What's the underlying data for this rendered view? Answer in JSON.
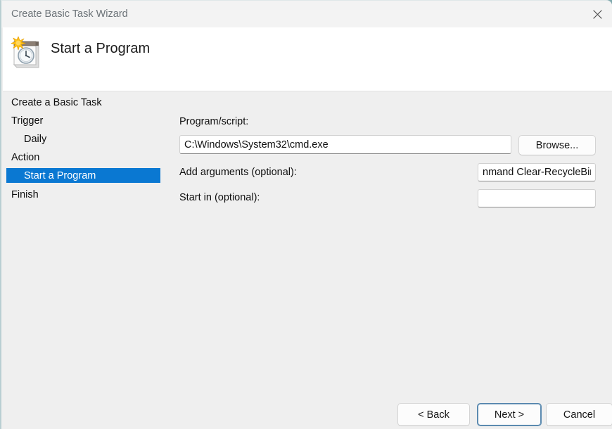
{
  "window": {
    "title": "Create Basic Task Wizard",
    "close_icon": "close-icon"
  },
  "header": {
    "title": "Start a Program",
    "icon": "scheduled-task-icon"
  },
  "sidebar": {
    "items": [
      {
        "label": "Create a Basic Task",
        "indent": false,
        "selected": false
      },
      {
        "label": "Trigger",
        "indent": false,
        "selected": false
      },
      {
        "label": "Daily",
        "indent": true,
        "selected": false
      },
      {
        "label": "Action",
        "indent": false,
        "selected": false
      },
      {
        "label": "Start a Program",
        "indent": true,
        "selected": true
      },
      {
        "label": "Finish",
        "indent": false,
        "selected": false
      }
    ]
  },
  "form": {
    "program_label": "Program/script:",
    "program_value": "C:\\Windows\\System32\\cmd.exe",
    "program_placeholder": "",
    "browse_label": "Browse...",
    "arguments_label": "Add arguments (optional):",
    "arguments_value": "nmand Clear-RecycleBin\"",
    "arguments_placeholder": "",
    "startin_label": "Start in (optional):",
    "startin_value": "",
    "startin_placeholder": ""
  },
  "footer": {
    "back_label": "< Back",
    "next_label": "Next >",
    "cancel_label": "Cancel"
  },
  "colors": {
    "selection_blue": "#0a78d2",
    "default_button_border": "#5b8ab0",
    "window_background": "#efefef",
    "header_background": "#ffffff",
    "titlebar_text": "#6c7378"
  }
}
